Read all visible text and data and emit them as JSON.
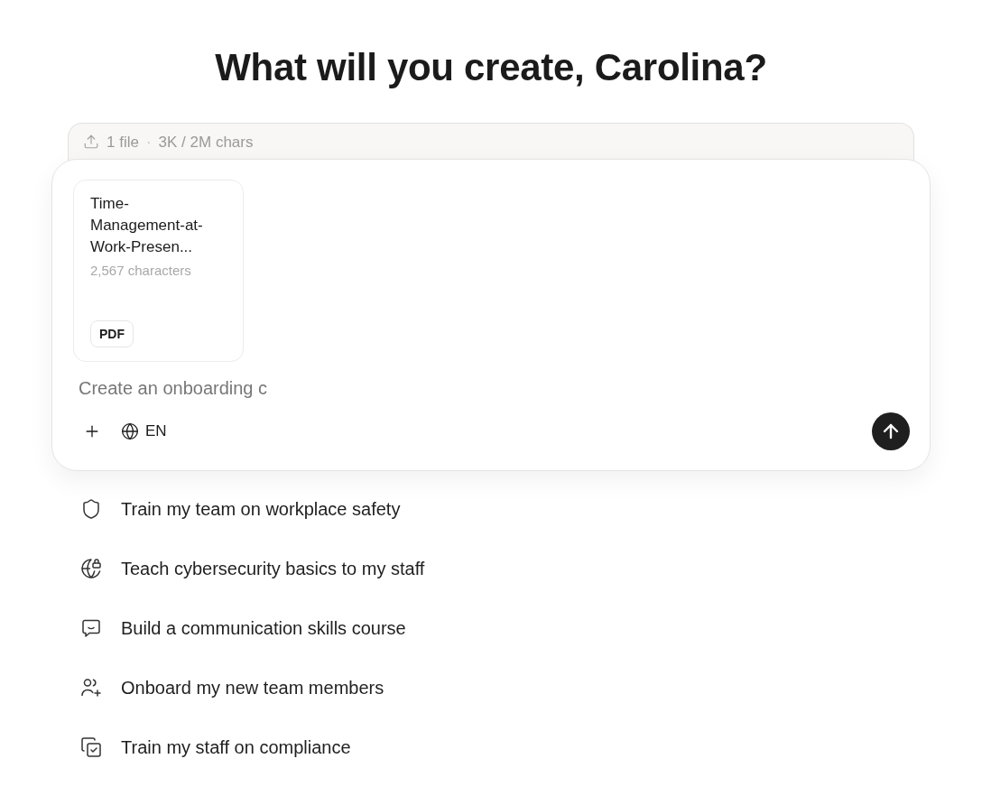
{
  "heading": "What will you create, Carolina?",
  "upload_bar": {
    "file_count": "1 file",
    "separator": "·",
    "usage": "3K / 2M chars"
  },
  "composer": {
    "attachments": [
      {
        "name": "Time-Management-at-Work-Presen...",
        "characters": "2,567 characters",
        "type": "PDF"
      }
    ],
    "input": {
      "placeholder": "Create an onboarding c"
    },
    "language": "EN"
  },
  "suggestions": [
    {
      "label": "Train my team on workplace safety"
    },
    {
      "label": "Teach cybersecurity basics to my staff"
    },
    {
      "label": "Build a communication skills course"
    },
    {
      "label": "Onboard my new team members"
    },
    {
      "label": "Train my staff on compliance"
    }
  ]
}
